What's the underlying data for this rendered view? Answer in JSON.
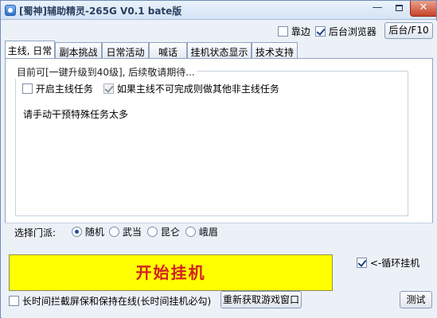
{
  "window": {
    "title": "[蜀神]辅助精灵-265G V0.1 bate版",
    "close_glyph": "✕",
    "minimize_glyph": "—"
  },
  "toolbar": {
    "dock_label": "靠边",
    "dock_checked": false,
    "bg_browser_label": "后台浏览器",
    "bg_browser_checked": true,
    "bg_button_label": "后台/F10"
  },
  "tabs": [
    {
      "label": "主线, 日常",
      "active": true
    },
    {
      "label": "副本挑战",
      "active": false
    },
    {
      "label": "日常活动",
      "active": false
    },
    {
      "label": "喊话",
      "active": false
    },
    {
      "label": "挂机状态显示",
      "active": false
    },
    {
      "label": "技术支持",
      "active": false
    }
  ],
  "main_panel": {
    "group_title": "目前可[一键升级到40级], 后续敬请期待...",
    "auto_main_label": "开启主线任务",
    "auto_main_checked": false,
    "fallback_label": "如果主线不可完成则做其他非主线任务",
    "fallback_checked": true,
    "note": "请手动干预特殊任务太多"
  },
  "sect": {
    "label": "选择门派:",
    "options": [
      "随机",
      "武当",
      "昆仑",
      "峨眉"
    ],
    "selected": "随机"
  },
  "start_button_label": "开始挂机",
  "loop": {
    "label": "<-循环挂机",
    "checked": true
  },
  "footer": {
    "long_idle_label": "长时间拦截屏保和保持在线(长时间挂机必勾)",
    "long_idle_checked": false,
    "refresh_window_label": "重新获取游戏窗口",
    "test_label": "测试"
  },
  "colors": {
    "accent": "#ffff00",
    "start_text": "#d21f1f"
  }
}
